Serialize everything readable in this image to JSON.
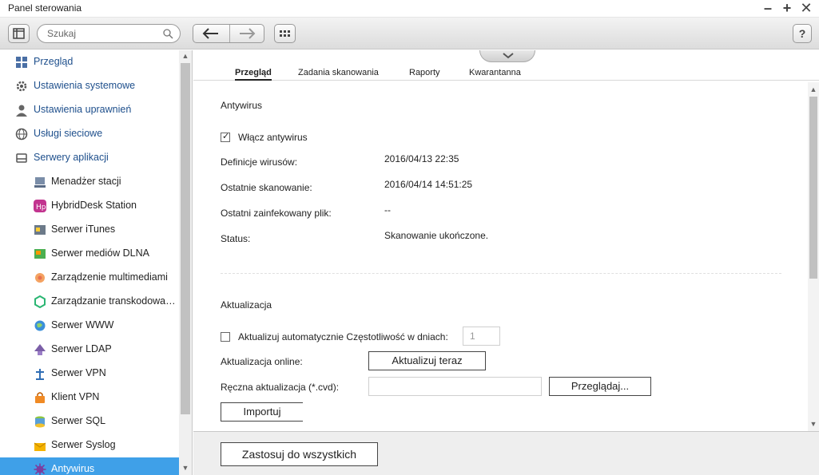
{
  "window": {
    "title": "Panel sterowania"
  },
  "toolbar": {
    "search_placeholder": "Szukaj",
    "help_label": "?"
  },
  "sidebar": {
    "items": [
      {
        "label": "Przegląd",
        "level": "top",
        "icon": "grid-icon"
      },
      {
        "label": "Ustawienia systemowe",
        "level": "top",
        "icon": "gear-icon"
      },
      {
        "label": "Ustawienia uprawnień",
        "level": "top",
        "icon": "user-icon"
      },
      {
        "label": "Usługi sieciowe",
        "level": "top",
        "icon": "globe-icon"
      },
      {
        "label": "Serwery aplikacji",
        "level": "top",
        "icon": "server-icon"
      },
      {
        "label": "Menadżer stacji",
        "level": "sub",
        "icon": "station-icon"
      },
      {
        "label": "HybridDesk Station",
        "level": "sub",
        "icon": "hybriddesk-icon"
      },
      {
        "label": "Serwer iTunes",
        "level": "sub",
        "icon": "itunes-icon"
      },
      {
        "label": "Serwer mediów DLNA",
        "level": "sub",
        "icon": "dlna-icon"
      },
      {
        "label": "Zarządzenie multimediami",
        "level": "sub",
        "icon": "multimedia-icon"
      },
      {
        "label": "Zarządzanie transkodowa…",
        "level": "sub",
        "icon": "transcode-icon"
      },
      {
        "label": "Serwer WWW",
        "level": "sub",
        "icon": "www-icon"
      },
      {
        "label": "Serwer LDAP",
        "level": "sub",
        "icon": "ldap-icon"
      },
      {
        "label": "Serwer VPN",
        "level": "sub",
        "icon": "vpn-server-icon"
      },
      {
        "label": "Klient VPN",
        "level": "sub",
        "icon": "vpn-client-icon"
      },
      {
        "label": "Serwer SQL",
        "level": "sub",
        "icon": "sql-icon"
      },
      {
        "label": "Serwer Syslog",
        "level": "sub",
        "icon": "syslog-icon"
      },
      {
        "label": "Antywirus",
        "level": "sub",
        "icon": "antivirus-icon",
        "active": true
      }
    ]
  },
  "tabs": [
    {
      "label": "Przegląd",
      "active": true
    },
    {
      "label": "Zadania skanowania",
      "active": false
    },
    {
      "label": "Raporty",
      "active": false
    },
    {
      "label": "Kwarantanna",
      "active": false
    }
  ],
  "antivirus": {
    "section_title": "Antywirus",
    "enable_label": "Włącz antywirus",
    "enable_checked": true,
    "rows": [
      {
        "label": "Definicje wirusów:",
        "value": "2016/04/13 22:35"
      },
      {
        "label": "Ostatnie skanowanie:",
        "value": "2016/04/14 14:51:25"
      },
      {
        "label": "Ostatni zainfekowany plik:",
        "value": "--"
      },
      {
        "label": "Status:",
        "value": "Skanowanie ukończone."
      }
    ]
  },
  "update": {
    "section_title": "Aktualizacja",
    "auto_label": "Aktualizuj automatycznie Częstotliwość w dniach:",
    "auto_checked": false,
    "frequency_value": "1",
    "online_label": "Aktualizacja online:",
    "update_now_label": "Aktualizuj teraz",
    "manual_label": "Ręczna aktualizacja (*.cvd):",
    "manual_file_value": "",
    "browse_label": "Przeglądaj...",
    "import_label": "Importuj"
  },
  "footer": {
    "apply_all_label": "Zastosuj do wszystkich"
  }
}
